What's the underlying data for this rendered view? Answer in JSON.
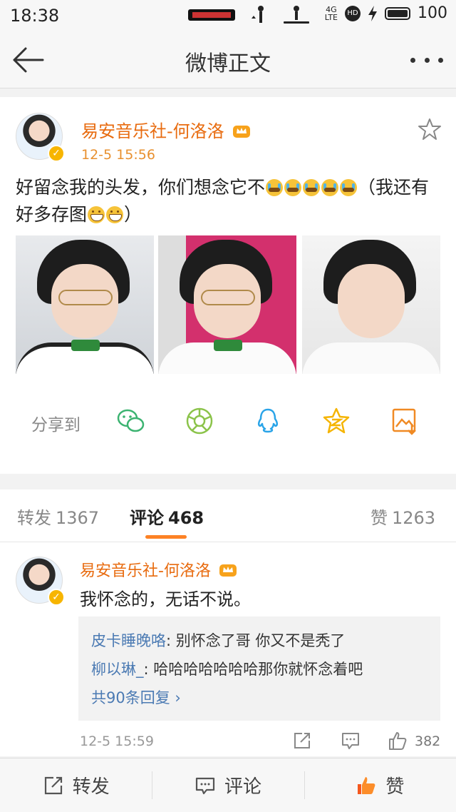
{
  "status_bar": {
    "time": "18:38",
    "network": "4G",
    "network_sub": "LTE",
    "hd": "HD",
    "battery": "100"
  },
  "nav": {
    "title": "微博正文"
  },
  "post": {
    "author": "易安音乐社-何洛洛",
    "time": "12-5 15:56",
    "text_part1": "好留念我的头发，你们想念它不",
    "text_part2": "（我还有好多存图",
    "text_part3": "）",
    "share_label": "分享到",
    "share_targets": [
      "wechat-icon",
      "moments-icon",
      "qq-icon",
      "qzone-icon",
      "save-image-icon"
    ]
  },
  "tabs": {
    "repost_label": "转发",
    "repost_count": "1367",
    "comment_label": "评论",
    "comment_count": "468",
    "like_label": "赞",
    "like_count": "1263"
  },
  "comment": {
    "author": "易安音乐社-何洛洛",
    "text": "我怀念的，无话不说。",
    "replies": [
      {
        "name": "皮卡睡晚咯",
        "text": ": 别怀念了哥 你又不是秃了"
      },
      {
        "name": "柳以琳_",
        "text": ": 哈哈哈哈哈哈哈那你就怀念着吧"
      }
    ],
    "more_replies": "共90条回复 ›",
    "time": "12-5 15:59",
    "likes": "382"
  },
  "toolbar": {
    "repost": "转发",
    "comment": "评论",
    "like": "赞"
  },
  "colors": {
    "accent_orange": "#fd8225",
    "username_orange": "#e86b0f",
    "link_blue": "#4b7ab3"
  }
}
